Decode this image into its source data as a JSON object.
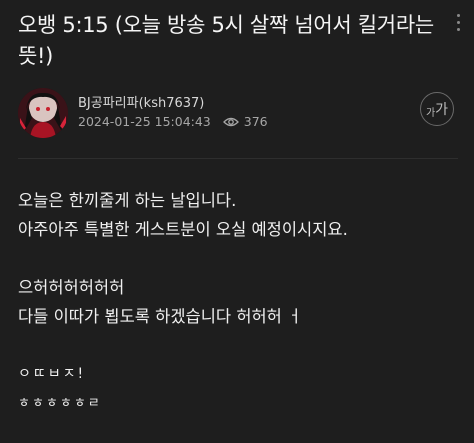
{
  "post": {
    "title": "오뱅 5:15 (오늘 방송 5시 살짝 넘어서 킬거라는 뜻!)",
    "author": "BJ공파리파(ksh7637)",
    "datetime": "2024-01-25 15:04:43",
    "views": "376"
  },
  "controls": {
    "font_size_small": "가",
    "font_size_big": "가"
  },
  "content": {
    "line1": "오늘은 한끼줄게 하는 날입니다.",
    "line2": "아주아주 특별한 게스트분이 오실 예정이시지요.",
    "line3": "으허허허허허허",
    "line4": "다들 이따가 뵙도록 하겠습니다 허허허 ㅓ",
    "line5": "ㅇㄸㅂㅈ!",
    "line6": "ㅎㅎㅎㅎㅎㄹ"
  }
}
